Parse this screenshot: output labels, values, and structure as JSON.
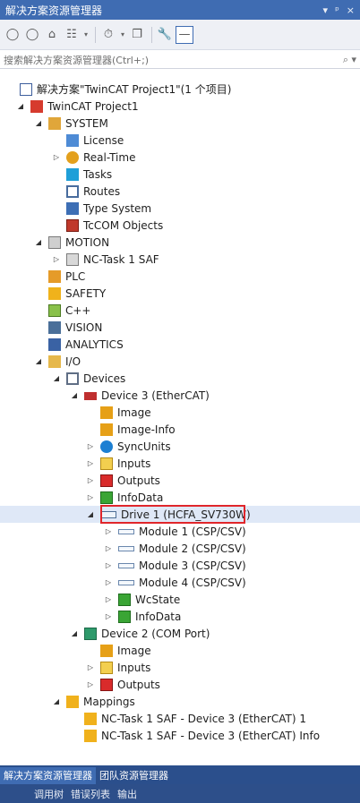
{
  "panel": {
    "title": "解决方案资源管理器",
    "controls": [
      "▾",
      "ᵖ",
      "×"
    ]
  },
  "toolbar": {
    "items": [
      {
        "name": "back-icon",
        "glyph": "◯"
      },
      {
        "name": "forward-icon",
        "glyph": "◯"
      },
      {
        "name": "home-icon",
        "glyph": "⌂"
      },
      {
        "name": "sync-icon",
        "glyph": "☷"
      },
      {
        "name": "sync-dropdown-icon",
        "glyph": "▾"
      },
      {
        "name": "history-icon",
        "glyph": "⏱"
      },
      {
        "name": "history-dropdown-icon",
        "glyph": "▾"
      },
      {
        "name": "copy-icon",
        "glyph": "❐"
      },
      {
        "name": "properties-icon",
        "glyph": "🔧"
      },
      {
        "name": "pin-icon",
        "glyph": "—"
      }
    ]
  },
  "search": {
    "placeholder": "搜索解决方案资源管理器(Ctrl+;)",
    "icon": "search-icon",
    "glyph": "⌕ ▾"
  },
  "tree": [
    {
      "label": "解决方案\"TwinCAT Project1\"(1 个项目)",
      "icon": "solution-icon",
      "cls": "i-sol",
      "indent": 0,
      "exp": ""
    },
    {
      "label": "TwinCAT Project1",
      "icon": "project-icon",
      "cls": "i-proj",
      "indent": 1,
      "exp": "◢"
    },
    {
      "label": "SYSTEM",
      "icon": "system-icon",
      "cls": "i-sys",
      "indent": 2,
      "exp": "◢"
    },
    {
      "label": "License",
      "icon": "license-icon",
      "cls": "i-lic",
      "indent": 3,
      "exp": ""
    },
    {
      "label": "Real-Time",
      "icon": "realtime-icon",
      "cls": "i-rt",
      "indent": 3,
      "exp": "▷"
    },
    {
      "label": "Tasks",
      "icon": "tasks-icon",
      "cls": "i-task",
      "indent": 3,
      "exp": ""
    },
    {
      "label": "Routes",
      "icon": "routes-icon",
      "cls": "i-route",
      "indent": 3,
      "exp": ""
    },
    {
      "label": "Type System",
      "icon": "type-system-icon",
      "cls": "i-type",
      "indent": 3,
      "exp": ""
    },
    {
      "label": "TcCOM Objects",
      "icon": "tccom-objects-icon",
      "cls": "i-tc",
      "indent": 3,
      "exp": ""
    },
    {
      "label": "MOTION",
      "icon": "motion-icon",
      "cls": "i-motion",
      "indent": 2,
      "exp": "◢"
    },
    {
      "label": "NC-Task 1 SAF",
      "icon": "nc-task-icon",
      "cls": "i-nc",
      "indent": 3,
      "exp": "▷"
    },
    {
      "label": "PLC",
      "icon": "plc-icon",
      "cls": "i-plc",
      "indent": 2,
      "exp": ""
    },
    {
      "label": "SAFETY",
      "icon": "safety-icon",
      "cls": "i-safe",
      "indent": 2,
      "exp": ""
    },
    {
      "label": "C++",
      "icon": "cpp-icon",
      "cls": "i-cpp",
      "indent": 2,
      "exp": ""
    },
    {
      "label": "VISION",
      "icon": "vision-icon",
      "cls": "i-vis",
      "indent": 2,
      "exp": ""
    },
    {
      "label": "ANALYTICS",
      "icon": "analytics-icon",
      "cls": "i-ana",
      "indent": 2,
      "exp": ""
    },
    {
      "label": "I/O",
      "icon": "io-icon",
      "cls": "i-io",
      "indent": 2,
      "exp": "◢"
    },
    {
      "label": "Devices",
      "icon": "devices-icon",
      "cls": "i-dev",
      "indent": 3,
      "exp": "◢"
    },
    {
      "label": "Device 3 (EtherCAT)",
      "icon": "ethercat-device-icon",
      "cls": "i-ecat",
      "indent": 4,
      "exp": "◢"
    },
    {
      "label": "Image",
      "icon": "image-icon",
      "cls": "i-img",
      "indent": 5,
      "exp": ""
    },
    {
      "label": "Image-Info",
      "icon": "image-info-icon",
      "cls": "i-img",
      "indent": 5,
      "exp": ""
    },
    {
      "label": "SyncUnits",
      "icon": "sync-units-icon",
      "cls": "i-sync",
      "indent": 5,
      "exp": "▷"
    },
    {
      "label": "Inputs",
      "icon": "inputs-icon",
      "cls": "i-in",
      "indent": 5,
      "exp": "▷"
    },
    {
      "label": "Outputs",
      "icon": "outputs-icon",
      "cls": "i-out",
      "indent": 5,
      "exp": "▷"
    },
    {
      "label": "InfoData",
      "icon": "infodata-icon",
      "cls": "i-info",
      "indent": 5,
      "exp": "▷"
    },
    {
      "label": "Drive 1 (HCFA_SV730W)",
      "icon": "drive-icon",
      "cls": "i-drv",
      "indent": 5,
      "exp": "◢",
      "selected": true
    },
    {
      "label": "Module 1 (CSP/CSV)",
      "icon": "module-icon",
      "cls": "i-mod",
      "indent": 6,
      "exp": "▷"
    },
    {
      "label": "Module 2 (CSP/CSV)",
      "icon": "module-icon",
      "cls": "i-mod",
      "indent": 6,
      "exp": "▷"
    },
    {
      "label": "Module 3 (CSP/CSV)",
      "icon": "module-icon",
      "cls": "i-mod",
      "indent": 6,
      "exp": "▷"
    },
    {
      "label": "Module 4 (CSP/CSV)",
      "icon": "module-icon",
      "cls": "i-mod",
      "indent": 6,
      "exp": "▷"
    },
    {
      "label": "WcState",
      "icon": "wcstate-icon",
      "cls": "i-info",
      "indent": 6,
      "exp": "▷"
    },
    {
      "label": "InfoData",
      "icon": "infodata-icon",
      "cls": "i-info",
      "indent": 6,
      "exp": "▷"
    },
    {
      "label": "Device 2 (COM Port)",
      "icon": "com-port-icon",
      "cls": "i-com",
      "indent": 4,
      "exp": "◢"
    },
    {
      "label": "Image",
      "icon": "image-icon",
      "cls": "i-img",
      "indent": 5,
      "exp": ""
    },
    {
      "label": "Inputs",
      "icon": "inputs-icon",
      "cls": "i-in",
      "indent": 5,
      "exp": "▷"
    },
    {
      "label": "Outputs",
      "icon": "outputs-icon",
      "cls": "i-out",
      "indent": 5,
      "exp": "▷"
    },
    {
      "label": "Mappings",
      "icon": "mappings-icon",
      "cls": "i-map",
      "indent": 3,
      "exp": "◢"
    },
    {
      "label": "NC-Task 1 SAF - Device 3 (EtherCAT) 1",
      "icon": "mapping-item-icon",
      "cls": "i-map",
      "indent": 4,
      "exp": ""
    },
    {
      "label": "NC-Task 1 SAF - Device 3 (EtherCAT) Info",
      "icon": "mapping-item-icon",
      "cls": "i-map",
      "indent": 4,
      "exp": ""
    }
  ],
  "tabs": [
    {
      "label": "解决方案资源管理器",
      "active": true
    },
    {
      "label": "团队资源管理器",
      "active": false
    }
  ],
  "bottom_tabs": [
    "调用树",
    "错误列表",
    "输出"
  ],
  "colors": {
    "title_bg": "#3f6cb2",
    "highlight_box": "#e0262b",
    "selection": "#dfe8f7"
  }
}
